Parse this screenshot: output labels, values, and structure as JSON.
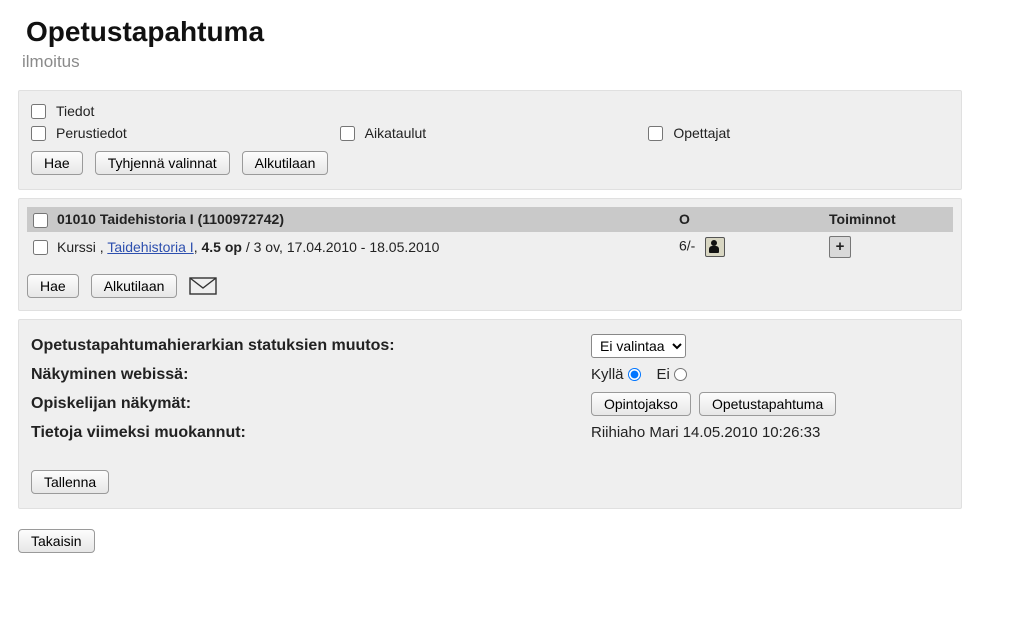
{
  "header": {
    "title": "Opetustapahtuma",
    "subtitle": "ilmoitus"
  },
  "filters": {
    "tiedot_label": "Tiedot",
    "perustiedot_label": "Perustiedot",
    "aikataulut_label": "Aikataulut",
    "opettajat_label": "Opettajat",
    "hae_label": "Hae",
    "tyhjenna_label": "Tyhjennä valinnat",
    "alkutilaan_label": "Alkutilaan"
  },
  "course": {
    "header_title": "01010 Taidehistoria I (1100972742)",
    "header_col2": "O",
    "header_col3": "Toiminnot",
    "row": {
      "prefix": "Kurssi , ",
      "link": "Taidehistoria I",
      "sep1": ", ",
      "op": "4.5 op",
      "rest": " / 3 ov, 17.04.2010 - 18.05.2010",
      "col2": "6/-"
    },
    "hae_label": "Hae",
    "alkutilaan_label": "Alkutilaan"
  },
  "status": {
    "hierarchy_label": "Opetustapahtumahierarkian statuksien muutos:",
    "hierarchy_selected": "Ei valintaa",
    "web_visibility_label": "Näkyminen webissä:",
    "yes_label": "Kyllä",
    "no_label": "Ei",
    "student_views_label": "Opiskelijan näkymät:",
    "opintojakso_btn": "Opintojakso",
    "opetustapahtuma_btn": "Opetustapahtuma",
    "last_edited_label": "Tietoja viimeksi muokannut:",
    "last_edited_value": "Riihiaho Mari 14.05.2010 10:26:33",
    "tallenna_label": "Tallenna"
  },
  "footer": {
    "takaisin_label": "Takaisin"
  }
}
